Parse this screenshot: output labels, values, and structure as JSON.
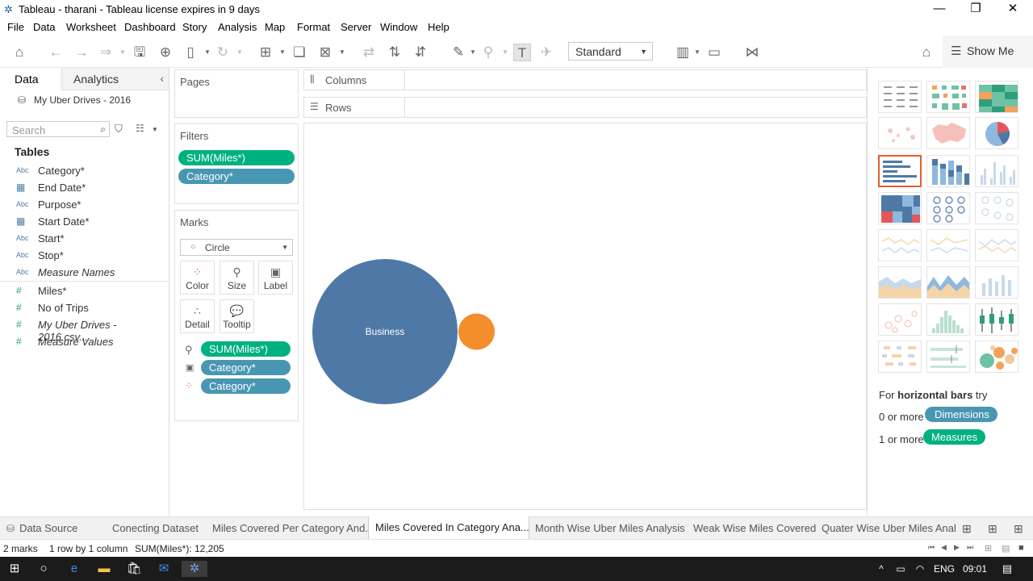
{
  "window": {
    "title": "Tableau - tharani - Tableau license expires in 9 days",
    "logo_icon": "tableau-logo-icon"
  },
  "menu": [
    "File",
    "Data",
    "Worksheet",
    "Dashboard",
    "Story",
    "Analysis",
    "Map",
    "Format",
    "Server",
    "Window",
    "Help"
  ],
  "toolbar": {
    "fit_value": "Standard",
    "show_me_label": "Show Me"
  },
  "left_panel": {
    "tab_data": "Data",
    "tab_analytics": "Analytics",
    "datasource": "My Uber Drives - 2016",
    "search_placeholder": "Search",
    "tables_heading": "Tables",
    "dimensions": [
      {
        "type": "Abc",
        "name": "Category*"
      },
      {
        "type": "cal",
        "name": "End Date*"
      },
      {
        "type": "Abc",
        "name": "Purpose*"
      },
      {
        "type": "cal",
        "name": "Start Date*"
      },
      {
        "type": "Abc",
        "name": "Start*"
      },
      {
        "type": "Abc",
        "name": "Stop*"
      },
      {
        "type": "Abc",
        "name": "Measure Names"
      }
    ],
    "measures": [
      {
        "type": "#",
        "name": "Miles*"
      },
      {
        "type": "#",
        "name": "No of Trips"
      },
      {
        "type": "#",
        "name": "My Uber Drives - 2016.csv..."
      },
      {
        "type": "#",
        "name": "Measure Values"
      }
    ]
  },
  "cards": {
    "pages_title": "Pages",
    "filters_title": "Filters",
    "filters": [
      "SUM(Miles*)",
      "Category*"
    ],
    "marks_title": "Marks",
    "mark_type": "Circle",
    "mark_buttons": [
      "Color",
      "Size",
      "Label",
      "Detail",
      "Tooltip"
    ],
    "mark_pills": [
      "SUM(Miles*)",
      "Category*",
      "Category*"
    ]
  },
  "shelves": {
    "columns": "Columns",
    "rows": "Rows"
  },
  "viz": {
    "marks": [
      {
        "label": "Business",
        "miles": 11487,
        "color": "#4e79a7"
      },
      {
        "label": "",
        "miles": 718,
        "color": "#f28e2b"
      }
    ]
  },
  "show_me": {
    "hint_prefix": "For ",
    "hint_bold": "horizontal bars",
    "hint_suffix": " try",
    "req1_prefix": "0 or more",
    "req1_pill": "Dimensions",
    "req2_prefix": "1 or more",
    "req2_pill": "Measures"
  },
  "sheet_tabs": [
    {
      "label": "Data Source",
      "active": false
    },
    {
      "label": "Conecting Dataset",
      "active": false
    },
    {
      "label": "Miles Covered Per Category And...",
      "active": false
    },
    {
      "label": "Miles Covered In Category Ana...",
      "active": true
    },
    {
      "label": "Month Wise Uber Miles Analysis",
      "active": false
    },
    {
      "label": "Weak Wise Miles Covered",
      "active": false
    },
    {
      "label": "Quater Wise Uber Miles Analysis",
      "active": false
    }
  ],
  "status": {
    "marks": "2 marks",
    "layout": "1 row by 1 column",
    "sum": "SUM(Miles*): 12,205"
  },
  "taskbar": {
    "lang": "ENG",
    "time": "09:01"
  }
}
